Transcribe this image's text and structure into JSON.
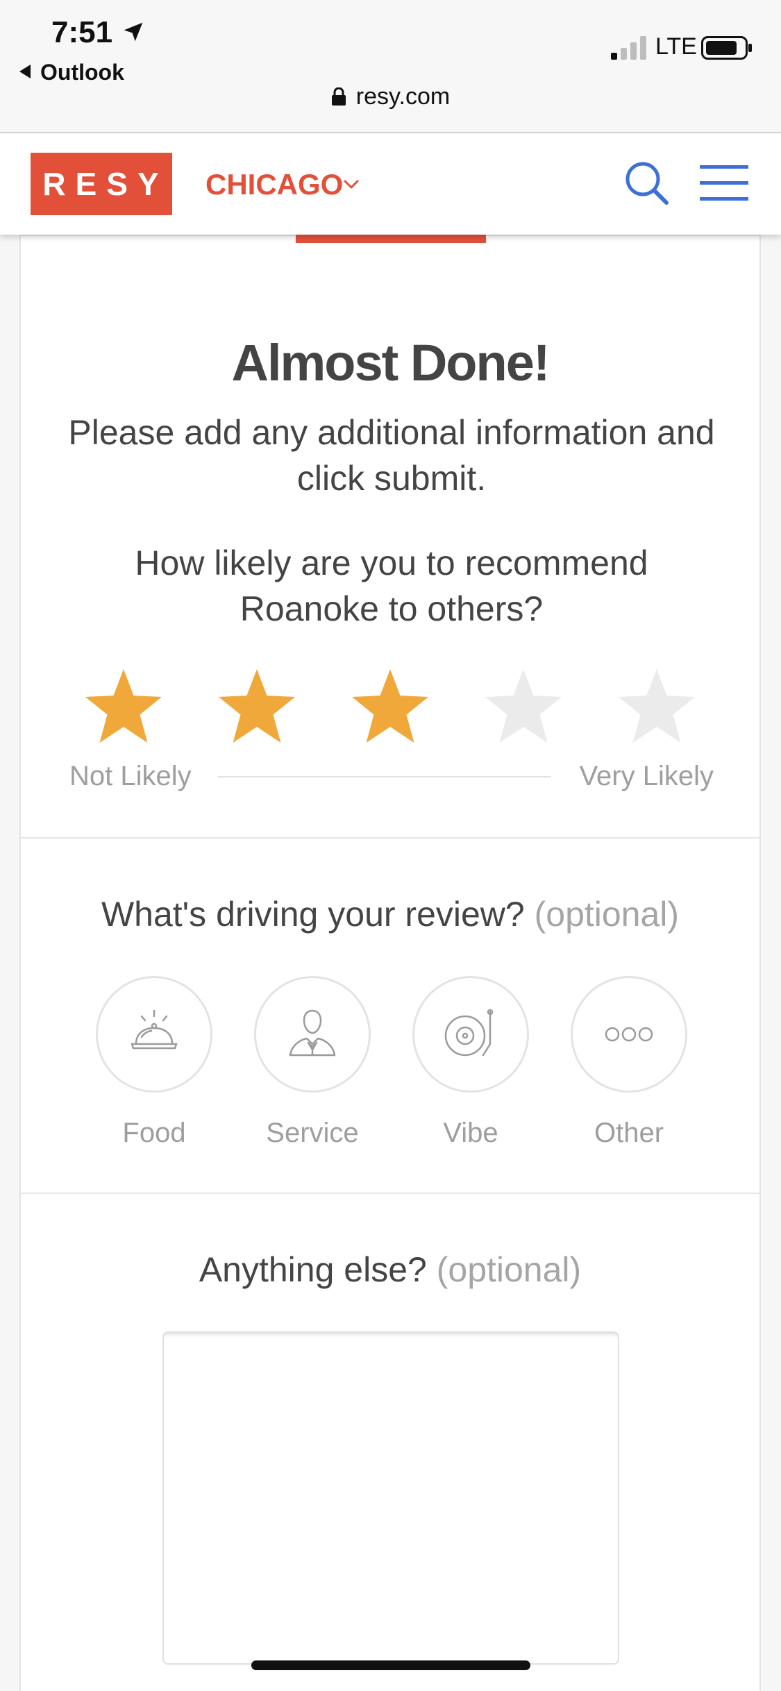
{
  "status_bar": {
    "time": "7:51",
    "back_app": "Outlook",
    "network": "LTE",
    "url": "resy.com"
  },
  "header": {
    "logo": "RESY",
    "city": "CHICAGO"
  },
  "survey": {
    "title": "Almost Done!",
    "subtitle": "Please add any additional information and click submit.",
    "question": "How likely are you to recommend Roanoke to others?",
    "rating": {
      "value": 3,
      "max": 5
    },
    "scale_low": "Not Likely",
    "scale_high": "Very Likely",
    "driving_title": "What's driving your review?",
    "optional_label": "(optional)",
    "drivers": [
      {
        "label": "Food",
        "icon": "cloche-icon"
      },
      {
        "label": "Service",
        "icon": "waiter-icon"
      },
      {
        "label": "Vibe",
        "icon": "turntable-icon"
      },
      {
        "label": "Other",
        "icon": "ellipsis-icon"
      }
    ],
    "anything_title": "Anything else?",
    "anything_value": ""
  },
  "colors": {
    "brand": "#e2503a",
    "link_blue": "#3d6fd6",
    "star_on": "#f0a83a",
    "star_off": "#ebebeb"
  }
}
